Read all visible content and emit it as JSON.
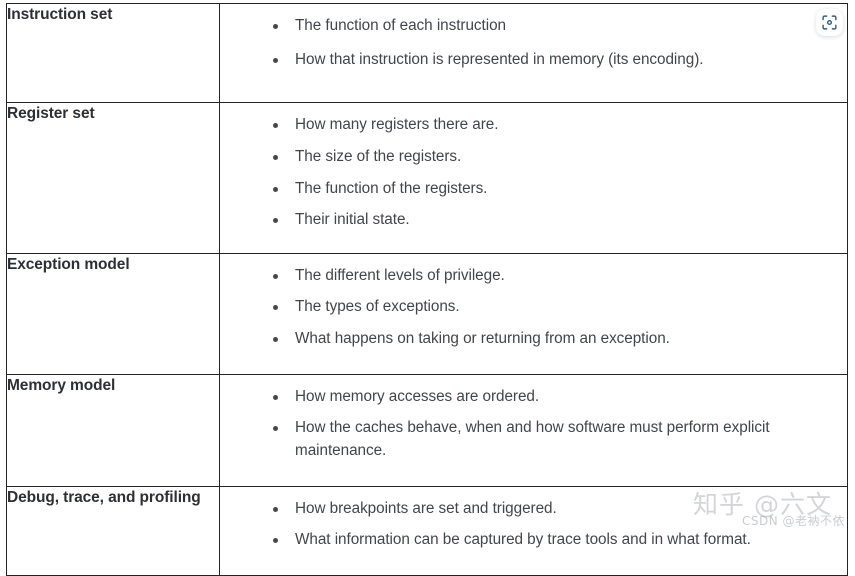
{
  "table": {
    "rows": [
      {
        "term": "Instruction set",
        "items": [
          "The function of each instruction",
          "How that instruction is represented in memory (its encoding)."
        ]
      },
      {
        "term": "Register set",
        "items": [
          "How many registers there are.",
          "The size of the registers.",
          "The function of the registers.",
          "Their initial state."
        ]
      },
      {
        "term": "Exception model",
        "items": [
          "The different levels of privilege.",
          "The types of exceptions.",
          "What happens on taking or returning from an exception."
        ]
      },
      {
        "term": "Memory model",
        "items": [
          "How memory accesses are ordered.",
          "How the caches behave, when and how software must perform explicit maintenance."
        ]
      },
      {
        "term": "Debug, trace, and profiling",
        "items": [
          "How breakpoints are set and triggered.",
          "What information can be captured by trace tools and in what format."
        ]
      }
    ]
  },
  "overlay": {
    "scan_button": {
      "icon": "scan-focus-icon",
      "color": "#2c5f8d"
    }
  },
  "watermarks": {
    "zhihu": "知乎 @六文",
    "csdn": "CSDN @老衲不依"
  },
  "colors": {
    "page_background": "#ffffff",
    "table_border": "#222428",
    "term_text": "#2b3035",
    "body_text": "#40464c",
    "bullet": "#44484d",
    "scan_icon": "#2c5f8d",
    "watermark": "#969ba2"
  }
}
